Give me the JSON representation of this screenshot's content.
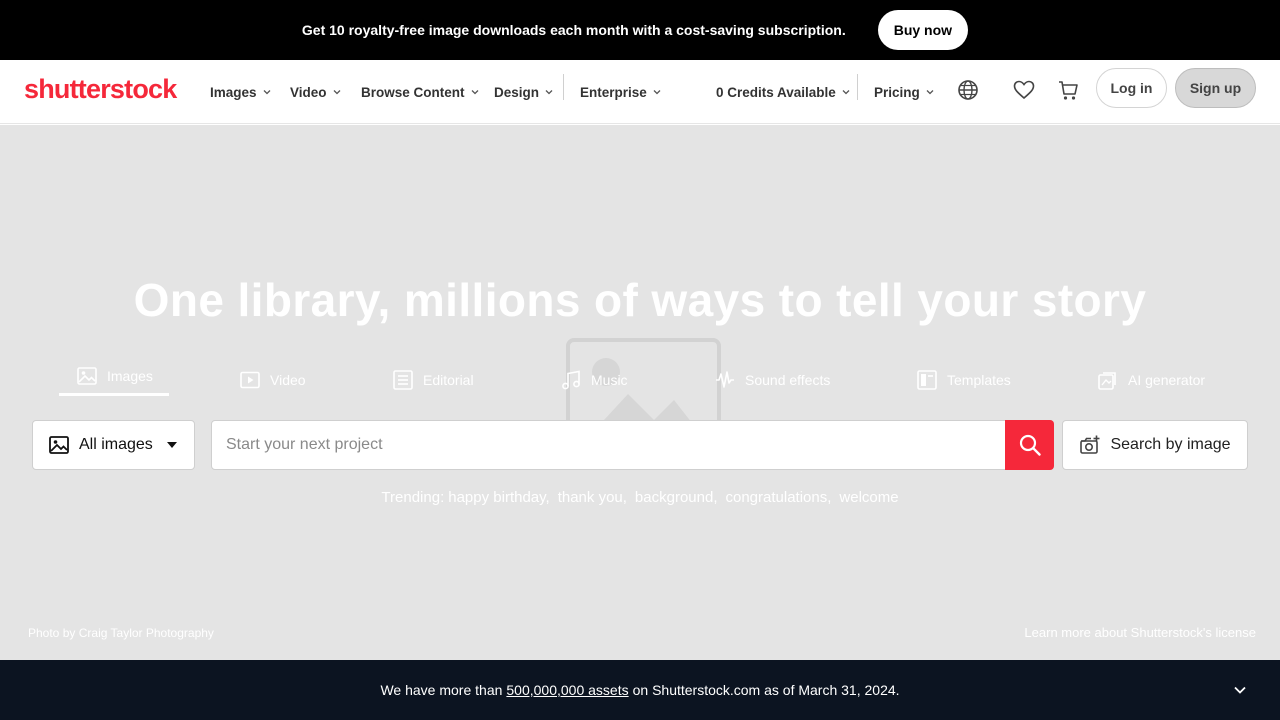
{
  "promo": {
    "text": "Get 10 royalty-free image downloads each month with a cost-saving subscription.",
    "button": "Buy now"
  },
  "header": {
    "logo": "shutterstock",
    "nav": [
      {
        "label": "Images"
      },
      {
        "label": "Video"
      },
      {
        "label": "Browse Content"
      },
      {
        "label": "Design"
      },
      {
        "label": "Enterprise"
      }
    ],
    "credits": "0 Credits Available",
    "pricing": "Pricing",
    "login": "Log in",
    "signup": "Sign up",
    "icons": [
      "globe-icon",
      "heart-icon",
      "cart-icon"
    ]
  },
  "hero": {
    "title": "One library, millions of ways to tell your story",
    "tabs": [
      {
        "label": "Images",
        "icon": "image-icon",
        "active": true
      },
      {
        "label": "Video",
        "icon": "video-icon"
      },
      {
        "label": "Editorial",
        "icon": "editorial-icon"
      },
      {
        "label": "Music",
        "icon": "music-icon"
      },
      {
        "label": "Sound effects",
        "icon": "waveform-icon"
      },
      {
        "label": "Templates",
        "icon": "templates-icon"
      },
      {
        "label": "AI generator",
        "icon": "ai-generator-icon"
      }
    ],
    "type_select": "All images",
    "search_placeholder": "Start your next project",
    "image_search": "Search by image",
    "trending_label": "Trending:",
    "trending": [
      "happy birthday,",
      "thank you,",
      "background,",
      "congratulations,",
      "welcome"
    ],
    "credit_photo": "Photo",
    "credit_by": "by",
    "credit_author": "Craig Taylor Photography",
    "license_prefix": "Learn more about",
    "license_link": "Shutterstock's license"
  },
  "bottombar": {
    "prefix": "We have more than",
    "link": "500,000,000 assets",
    "suffix": "on Shutterstock.com as of March 31, 2024."
  },
  "colors": {
    "brand": "#f5283a",
    "banner": "#000000",
    "bottombar": "#0c1421"
  }
}
